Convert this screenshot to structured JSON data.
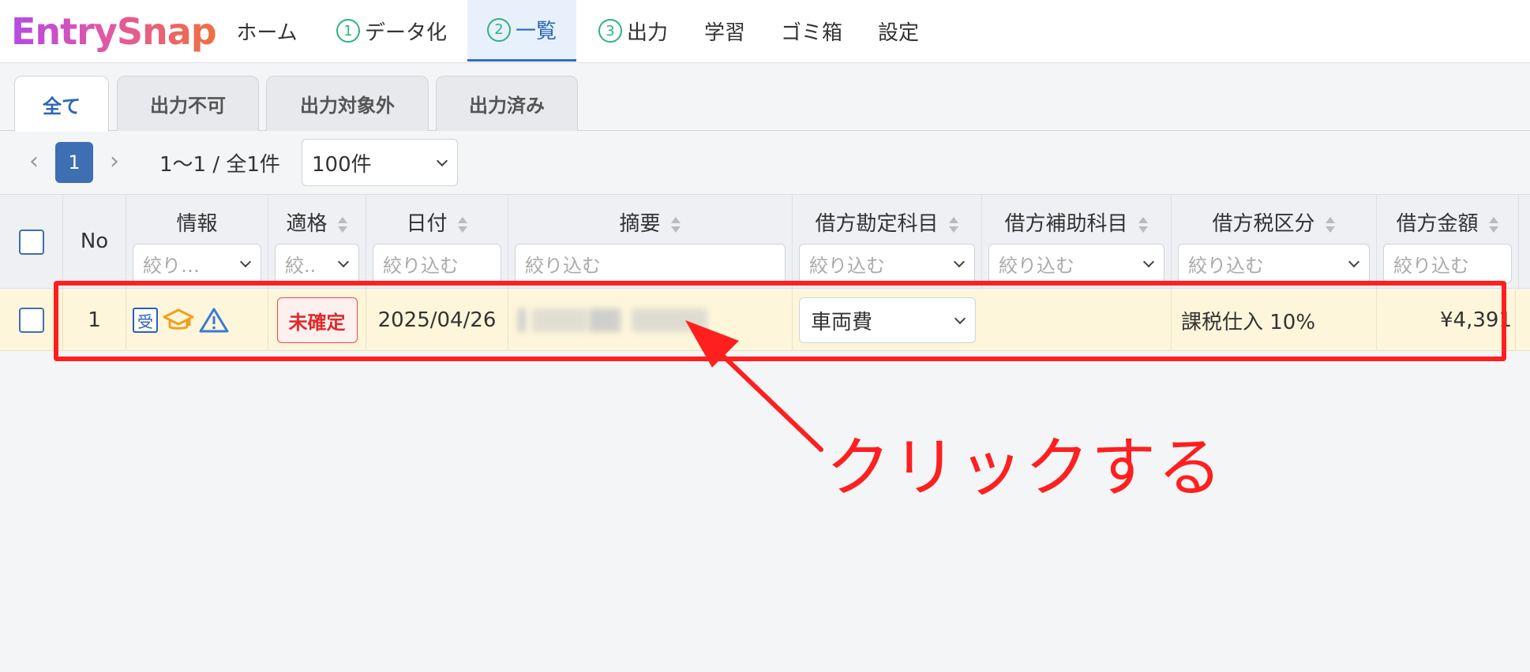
{
  "app": {
    "logo": "EntrySnap"
  },
  "nav": {
    "home": "ホーム",
    "data": {
      "num": "1",
      "label": "データ化"
    },
    "list": {
      "num": "2",
      "label": "一覧"
    },
    "output": {
      "num": "3",
      "label": "出力"
    },
    "learn": "学習",
    "trash": "ゴミ箱",
    "settings": "設定"
  },
  "tabs": [
    "全て",
    "出力不可",
    "出力対象外",
    "出力済み"
  ],
  "pagination": {
    "page": "1",
    "info": "1〜1 / 全1件",
    "per_page": "100件"
  },
  "table": {
    "headers": {
      "no": "No",
      "info": "情報",
      "qualified": "適格",
      "date": "日付",
      "summary": "摘要",
      "debit_account": "借方勘定科目",
      "debit_sub": "借方補助科目",
      "debit_tax": "借方税区分",
      "debit_amount": "借方金額"
    },
    "filters": {
      "info": "絞り…",
      "qualified": "絞..",
      "date": "絞り込む",
      "summary": "絞り込む",
      "debit_account": "絞り込む",
      "debit_sub": "絞り込む",
      "debit_tax": "絞り込む",
      "debit_amount": "絞り込む"
    },
    "rows": [
      {
        "no": "1",
        "info_badge": "受",
        "status": "未確定",
        "date": "2025/04/26",
        "debit_account": "車両費",
        "debit_sub": "",
        "debit_tax": "課税仕入 10%",
        "debit_amount": "¥4,391"
      }
    ]
  },
  "annotation": {
    "text": "クリックする",
    "color": "#ff1f1f"
  },
  "colors": {
    "accent": "#3f6fb3",
    "row_highlight": "#fdf6da",
    "status_red": "#e02a2a"
  }
}
